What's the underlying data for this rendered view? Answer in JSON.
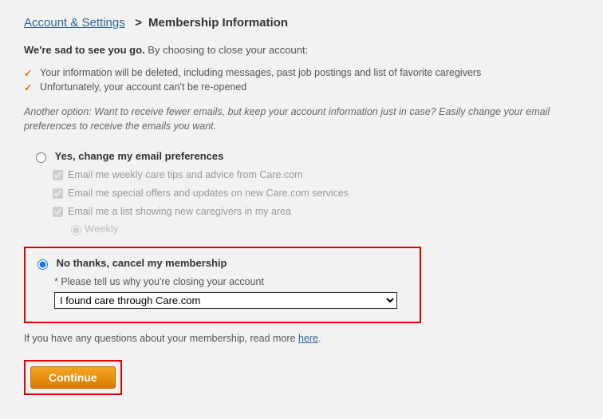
{
  "breadcrumb": {
    "link": "Account & Settings",
    "current": "Membership Information"
  },
  "intro": {
    "bold": "We're sad to see you go.",
    "rest": " By choosing to close your account:"
  },
  "bullets": [
    "Your information will be deleted, including messages, past job postings and list of favorite caregivers",
    "Unfortunately, your account can't be re-opened"
  ],
  "note": "Another option: Want to receive fewer emails, but keep your account information just in case? Easily change your email preferences to receive the emails you want.",
  "option1": {
    "label": "Yes, change my email preferences",
    "cb1": "Email me weekly care tips and advice from Care.com",
    "cb2": "Email me special offers and updates on new Care.com services",
    "cb3": "Email me a list showing new caregivers in my area",
    "freq": "Weekly"
  },
  "option2": {
    "label": "No thanks, cancel my membership",
    "reason_label": "* Please tell us why you're closing your account",
    "reason_value": "I found care through Care.com"
  },
  "questions": {
    "text": "If you have any questions about your membership, read more ",
    "link": "here"
  },
  "continue": "Continue"
}
